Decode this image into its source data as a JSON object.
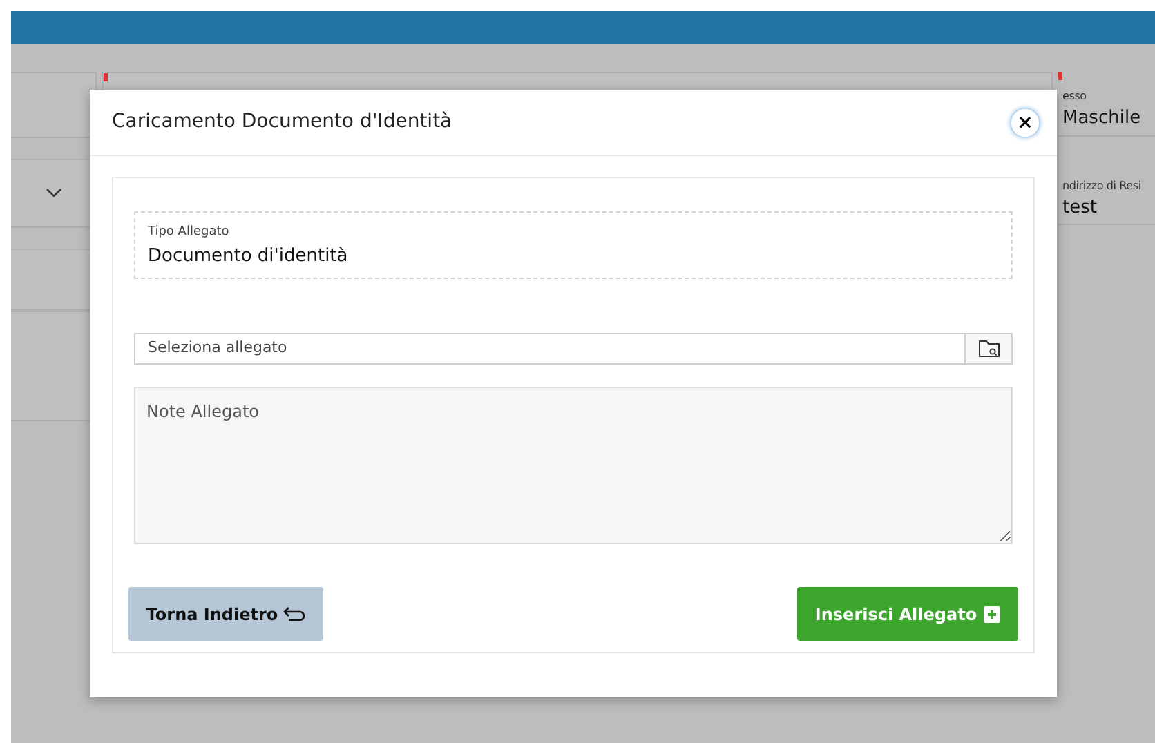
{
  "background": {
    "fields": [
      {
        "label": "esso",
        "value": "Maschile"
      },
      {
        "label": "ndirizzo di Resi",
        "value": "test"
      }
    ]
  },
  "modal": {
    "title": "Caricamento Documento d'Identità",
    "close": "×",
    "type_field": {
      "label": "Tipo Allegato",
      "value": "Documento di'identità"
    },
    "file_field": {
      "placeholder": "Seleziona allegato"
    },
    "notes": {
      "placeholder": "Note Allegato"
    },
    "buttons": [
      {
        "label": "Torna Indietro",
        "kind": "back"
      },
      {
        "label": "Inserisci Allegato",
        "kind": "insert"
      }
    ]
  }
}
